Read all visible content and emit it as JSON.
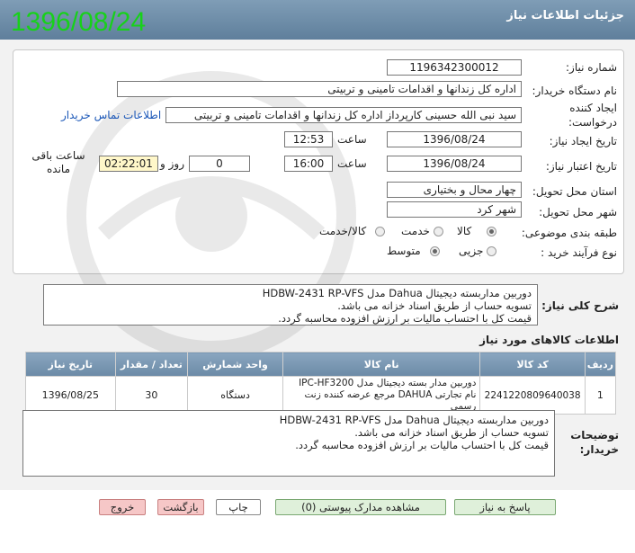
{
  "header": {
    "title": "جزئیات اطلاعات نیاز",
    "date_stamp": "1396/08/24"
  },
  "form": {
    "need_number": {
      "label": "شماره نیاز:",
      "value": "1196342300012"
    },
    "buyer_org": {
      "label": "نام دستگاه خریدار:",
      "value": "اداره کل زندانها و اقدامات تامینی و تربیتی"
    },
    "creator": {
      "label": "ایجاد کننده درخواست:",
      "value": "سید نبی الله حسینی کارپرداز اداره کل زندانها و اقدامات تامینی و تربیتی",
      "contact_link": "اطلاعات تماس خریدار"
    },
    "announce_date": {
      "label": "تاریخ ایجاد نیاز:",
      "date": "1396/08/24",
      "time_label": "ساعت",
      "time": "12:53"
    },
    "validity_date": {
      "label": "تاریخ اعتبار نیاز:",
      "date": "1396/08/24",
      "time_label": "ساعت",
      "time": "16:00",
      "days": "0",
      "days_label": "روز و",
      "remaining": "02:22:01",
      "remaining_label": "ساعت باقی مانده"
    },
    "province": {
      "label": "استان محل تحویل:",
      "value": "چهار محال و بختیاری"
    },
    "city": {
      "label": "شهر محل تحویل:",
      "value": "شهر کرد"
    },
    "category": {
      "label": "طبقه بندی موضوعی:",
      "options": [
        "کالا",
        "خدمت",
        "کالا/خدمت"
      ],
      "selected": "کالا"
    },
    "process": {
      "label": "نوع فرآیند خرید :",
      "options": [
        "جزیی",
        "متوسط"
      ],
      "selected": "متوسط"
    }
  },
  "general_desc": {
    "label": "شرح کلی نیاز:",
    "lines": [
      "دوربین مداربسته دیجیتال Dahua مدل HDBW-2431 RP-VFS",
      "تسویه حساب از طریق اسناد خزانه می باشد.",
      "قیمت کل با احتساب مالیات بر ارزش افزوده محاسبه گردد."
    ]
  },
  "items_section": {
    "title": "اطلاعات کالاهای مورد نیاز",
    "headers": [
      "ردیف",
      "کد کالا",
      "نام کالا",
      "واحد شمارش",
      "تعداد / مقدار",
      "تاریخ نیاز"
    ],
    "rows": [
      {
        "row": "1",
        "code": "2241220809640038",
        "name": "دوربین مدار بسته دیجیتال مدل IPC-HF3200 نام تجارتی DAHUA مرجع عرضه کننده زنت رسمی",
        "unit": "دستگاه",
        "qty": "30",
        "date": "1396/08/25"
      }
    ]
  },
  "buyer_notes": {
    "label": "توضیحات خریدار:",
    "lines": [
      "دوربین مداربسته دیجیتال Dahua مدل HDBW-2431 RP-VFS",
      "تسویه حساب از طریق اسناد خزانه می باشد.",
      "قیمت کل با احتساب مالیات بر ارزش افزوده محاسبه گردد."
    ]
  },
  "buttons": {
    "reply": "پاسخ به نیاز",
    "attachments": "مشاهده مدارک پیوستی (0)",
    "print": "چاپ",
    "back": "بازگشت",
    "exit": "خروج"
  },
  "colors": {
    "header": "#6f8fab",
    "date_stamp": "#17d11a",
    "link": "#1c58b8"
  }
}
